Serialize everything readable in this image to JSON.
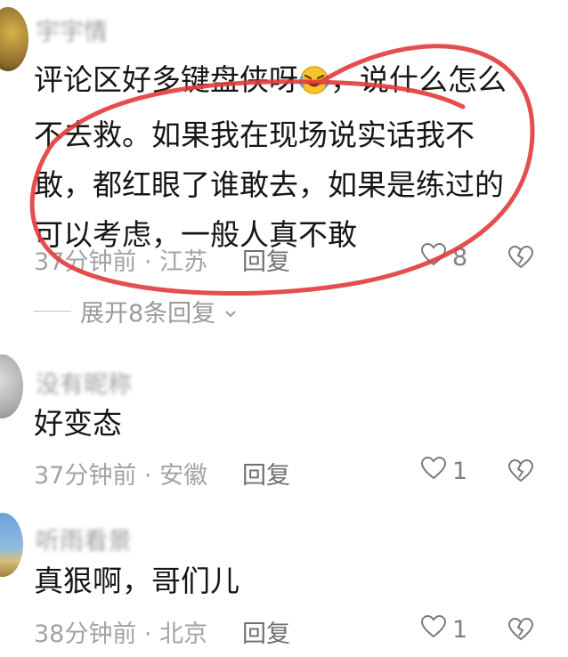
{
  "comments": [
    {
      "username": "宇宇情",
      "text_lines": [
        "评论区好多键盘侠呀",
        "，说什么怎么",
        "不去救。如果我在现场说实话我不",
        "敢，都红眼了谁敢去，如果是练过的",
        "可以考虑，一般人真不敢"
      ],
      "time": "37分钟前",
      "location": "江苏",
      "reply_label": "回复",
      "like_count": "8",
      "expand_label": "展开8条回复"
    },
    {
      "username": "没有昵称",
      "text": "好变态",
      "time": "37分钟前",
      "location": "安徽",
      "reply_label": "回复",
      "like_count": "1"
    },
    {
      "username": "听雨看景",
      "text": "真狠啊，哥们儿",
      "time": "38分钟前",
      "location": "北京",
      "reply_label": "回复",
      "like_count": "1"
    }
  ],
  "separator": " · ",
  "icons": {
    "emoji": "rofl-emoji-icon",
    "like": "heart-icon",
    "dislike": "broken-heart-icon",
    "expand": "chevron-down-icon"
  },
  "colors": {
    "annotation_circle": "#e23b3b"
  }
}
